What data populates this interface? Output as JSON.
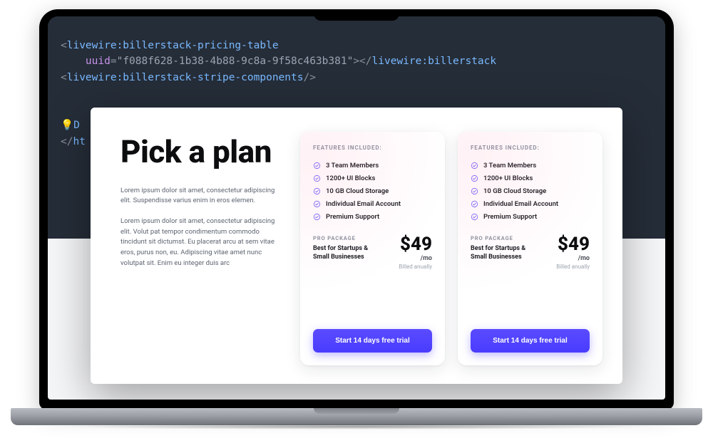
{
  "code": {
    "line1_tag": "livewire:billerstack-pricing-table",
    "line2_attr": "uuid",
    "line2_value": "f088f628-1b38-4b88-9c8a-9f58c463b381",
    "line1_close_tag": "livewire:billerstack",
    "line3_tag": "livewire:billerstack-stripe-components",
    "frag1_prefix": "💡",
    "frag1_tag_partial": "D",
    "frag2_close": "ht"
  },
  "heading": "Pick a plan",
  "para1": "Lorem ipsum dolor sit amet, consectetur adipiscing elit. Suspendisse varius enim in eros elemen.",
  "para2": "Lorem ipsum dolor sit amet, consectetur adipiscing elit. Volut pat tempor condimentum commodo tincidunt sit dictumst. Eu placerat arcu at sem vitae eros, purus non, eu. Adipiscing vitae amet nunc volutpat sit. Enim eu integer duis arc",
  "cards": [
    {
      "features_label": "FEATURES INCLUDED:",
      "features": [
        "3 Team Members",
        "1200+ UI Blocks",
        "10 GB Cloud Storage",
        "Individual Email Account",
        "Premium Support"
      ],
      "pkg_label": "PRO PACKAGE",
      "pkg_desc": "Best for Startups & Small Businesses",
      "price": "$49",
      "per": "/mo",
      "billed": "Billed anually",
      "cta": "Start 14 days free trial"
    },
    {
      "features_label": "FEATURES INCLUDED:",
      "features": [
        "3 Team Members",
        "1200+ UI Blocks",
        "10 GB Cloud Storage",
        "Individual Email Account",
        "Premium Support"
      ],
      "pkg_label": "PRO PACKAGE",
      "pkg_desc": "Best for Startups & Small Businesses",
      "price": "$49",
      "per": "/mo",
      "billed": "Billed anually",
      "cta": "Start 14 days free trial"
    }
  ],
  "colors": {
    "accent": "#4a3cff",
    "check": "#7c6cff"
  }
}
